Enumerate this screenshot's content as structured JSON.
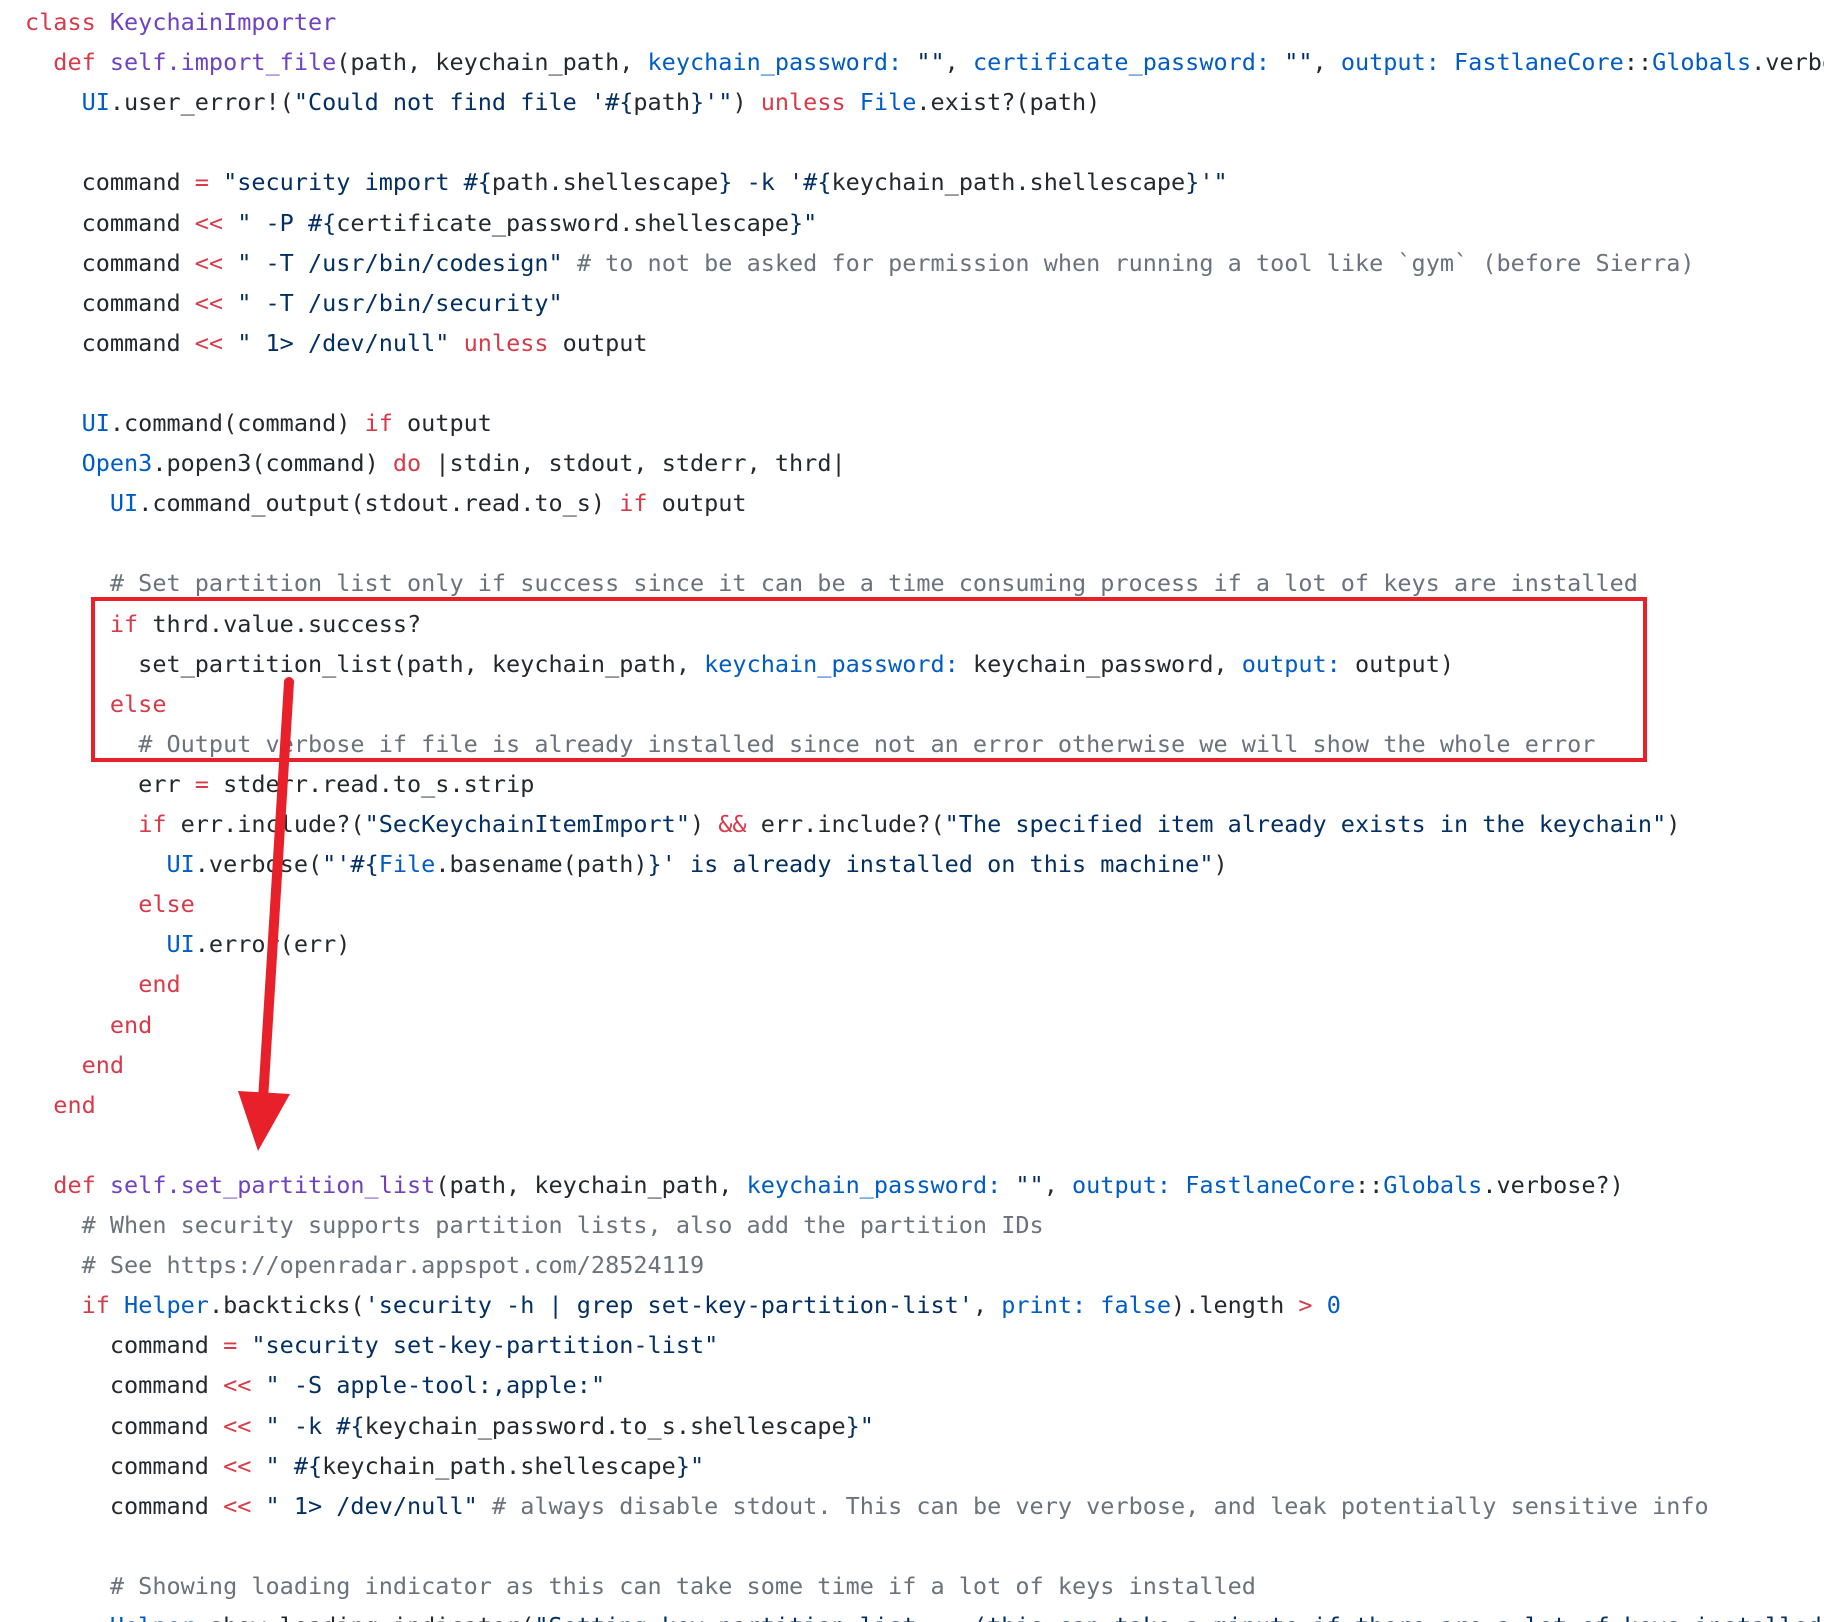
{
  "colors": {
    "keyword": "#d73a49",
    "class_name": "#6f42c1",
    "constant": "#005cc5",
    "string": "#032f62",
    "comment": "#6a737d",
    "text": "#24292e",
    "annotation": "#e8202a"
  },
  "code": {
    "language": "ruby",
    "lines": [
      [
        [
          "kw",
          "class "
        ],
        [
          "cls",
          "KeychainImporter"
        ]
      ],
      [
        [
          "p",
          "  "
        ],
        [
          "kw",
          "def "
        ],
        [
          "fn",
          "self.import_file"
        ],
        [
          "p",
          "(path, keychain_path, "
        ],
        [
          "sym",
          "keychain_password:"
        ],
        [
          "p",
          " "
        ],
        [
          "str",
          "\"\""
        ],
        [
          "p",
          ", "
        ],
        [
          "sym",
          "certificate_password:"
        ],
        [
          "p",
          " "
        ],
        [
          "str",
          "\"\""
        ],
        [
          "p",
          ", "
        ],
        [
          "sym",
          "output:"
        ],
        [
          "p",
          " "
        ],
        [
          "const",
          "FastlaneCore"
        ],
        [
          "p",
          "::"
        ],
        [
          "const",
          "Globals"
        ],
        [
          "p",
          ".verbose?)"
        ]
      ],
      [
        [
          "p",
          "    "
        ],
        [
          "const",
          "UI"
        ],
        [
          "p",
          ".user_error!("
        ],
        [
          "str",
          "\"Could not find file '#{"
        ],
        [
          "p",
          "path"
        ],
        [
          "str",
          "}'\""
        ],
        [
          "p",
          ") "
        ],
        [
          "kw",
          "unless"
        ],
        [
          "p",
          " "
        ],
        [
          "const",
          "File"
        ],
        [
          "p",
          ".exist?(path)"
        ]
      ],
      [],
      [
        [
          "p",
          "    command "
        ],
        [
          "op",
          "="
        ],
        [
          "p",
          " "
        ],
        [
          "str",
          "\"security import #{"
        ],
        [
          "p",
          "path.shellescape"
        ],
        [
          "str",
          "} -k '#{"
        ],
        [
          "p",
          "keychain_path.shellescape"
        ],
        [
          "str",
          "}'\""
        ]
      ],
      [
        [
          "p",
          "    command "
        ],
        [
          "op",
          "<<"
        ],
        [
          "p",
          " "
        ],
        [
          "str",
          "\" -P #{"
        ],
        [
          "p",
          "certificate_password.shellescape"
        ],
        [
          "str",
          "}\""
        ]
      ],
      [
        [
          "p",
          "    command "
        ],
        [
          "op",
          "<<"
        ],
        [
          "p",
          " "
        ],
        [
          "str",
          "\" -T /usr/bin/codesign\""
        ],
        [
          "p",
          " "
        ],
        [
          "cmt",
          "# to not be asked for permission when running a tool like `gym` (before Sierra)"
        ]
      ],
      [
        [
          "p",
          "    command "
        ],
        [
          "op",
          "<<"
        ],
        [
          "p",
          " "
        ],
        [
          "str",
          "\" -T /usr/bin/security\""
        ]
      ],
      [
        [
          "p",
          "    command "
        ],
        [
          "op",
          "<<"
        ],
        [
          "p",
          " "
        ],
        [
          "str",
          "\" 1> /dev/null\""
        ],
        [
          "p",
          " "
        ],
        [
          "kw",
          "unless"
        ],
        [
          "p",
          " output"
        ]
      ],
      [],
      [
        [
          "p",
          "    "
        ],
        [
          "const",
          "UI"
        ],
        [
          "p",
          ".command(command) "
        ],
        [
          "kw",
          "if"
        ],
        [
          "p",
          " output"
        ]
      ],
      [
        [
          "p",
          "    "
        ],
        [
          "const",
          "Open3"
        ],
        [
          "p",
          ".popen3(command) "
        ],
        [
          "kw",
          "do"
        ],
        [
          "p",
          " |stdin, stdout, stderr, thrd|"
        ]
      ],
      [
        [
          "p",
          "      "
        ],
        [
          "const",
          "UI"
        ],
        [
          "p",
          ".command_output(stdout.read.to_s) "
        ],
        [
          "kw",
          "if"
        ],
        [
          "p",
          " output"
        ]
      ],
      [],
      [
        [
          "p",
          "      "
        ],
        [
          "cmt",
          "# Set partition list only if success since it can be a time consuming process if a lot of keys are installed"
        ]
      ],
      [
        [
          "p",
          "      "
        ],
        [
          "kw",
          "if"
        ],
        [
          "p",
          " thrd.value.success?"
        ]
      ],
      [
        [
          "p",
          "        set_partition_list(path, keychain_path, "
        ],
        [
          "sym",
          "keychain_password:"
        ],
        [
          "p",
          " keychain_password, "
        ],
        [
          "sym",
          "output:"
        ],
        [
          "p",
          " output)"
        ]
      ],
      [
        [
          "p",
          "      "
        ],
        [
          "kw",
          "else"
        ]
      ],
      [
        [
          "p",
          "        "
        ],
        [
          "cmt",
          "# Output verbose if file is already installed since not an error otherwise we will show the whole error"
        ]
      ],
      [
        [
          "p",
          "        err "
        ],
        [
          "op",
          "="
        ],
        [
          "p",
          " stderr.read.to_s.strip"
        ]
      ],
      [
        [
          "p",
          "        "
        ],
        [
          "kw",
          "if"
        ],
        [
          "p",
          " err.include?("
        ],
        [
          "str",
          "\"SecKeychainItemImport\""
        ],
        [
          "p",
          ") "
        ],
        [
          "op",
          "&&"
        ],
        [
          "p",
          " err.include?("
        ],
        [
          "str",
          "\"The specified item already exists in the keychain\""
        ],
        [
          "p",
          ")"
        ]
      ],
      [
        [
          "p",
          "          "
        ],
        [
          "const",
          "UI"
        ],
        [
          "p",
          ".verbose("
        ],
        [
          "str",
          "\"'#{"
        ],
        [
          "const",
          "File"
        ],
        [
          "p",
          ".basename(path)"
        ],
        [
          "str",
          "}' is already installed on this machine\""
        ],
        [
          "p",
          ")"
        ]
      ],
      [
        [
          "p",
          "        "
        ],
        [
          "kw",
          "else"
        ]
      ],
      [
        [
          "p",
          "          "
        ],
        [
          "const",
          "UI"
        ],
        [
          "p",
          ".error(err)"
        ]
      ],
      [
        [
          "p",
          "        "
        ],
        [
          "kw",
          "end"
        ]
      ],
      [
        [
          "p",
          "      "
        ],
        [
          "kw",
          "end"
        ]
      ],
      [
        [
          "p",
          "    "
        ],
        [
          "kw",
          "end"
        ]
      ],
      [
        [
          "p",
          "  "
        ],
        [
          "kw",
          "end"
        ]
      ],
      [],
      [
        [
          "p",
          "  "
        ],
        [
          "kw",
          "def "
        ],
        [
          "fn",
          "self.set_partition_list"
        ],
        [
          "p",
          "(path, keychain_path, "
        ],
        [
          "sym",
          "keychain_password:"
        ],
        [
          "p",
          " "
        ],
        [
          "str",
          "\"\""
        ],
        [
          "p",
          ", "
        ],
        [
          "sym",
          "output:"
        ],
        [
          "p",
          " "
        ],
        [
          "const",
          "FastlaneCore"
        ],
        [
          "p",
          "::"
        ],
        [
          "const",
          "Globals"
        ],
        [
          "p",
          ".verbose?)"
        ]
      ],
      [
        [
          "p",
          "    "
        ],
        [
          "cmt",
          "# When security supports partition lists, also add the partition IDs"
        ]
      ],
      [
        [
          "p",
          "    "
        ],
        [
          "cmt",
          "# See https://openradar.appspot.com/28524119"
        ]
      ],
      [
        [
          "p",
          "    "
        ],
        [
          "kw",
          "if"
        ],
        [
          "p",
          " "
        ],
        [
          "const",
          "Helper"
        ],
        [
          "p",
          ".backticks("
        ],
        [
          "str",
          "'security -h | grep set-key-partition-list'"
        ],
        [
          "p",
          ", "
        ],
        [
          "sym",
          "print:"
        ],
        [
          "p",
          " "
        ],
        [
          "const",
          "false"
        ],
        [
          "p",
          ").length "
        ],
        [
          "op",
          ">"
        ],
        [
          "p",
          " "
        ],
        [
          "num",
          "0"
        ]
      ],
      [
        [
          "p",
          "      command "
        ],
        [
          "op",
          "="
        ],
        [
          "p",
          " "
        ],
        [
          "str",
          "\"security set-key-partition-list\""
        ]
      ],
      [
        [
          "p",
          "      command "
        ],
        [
          "op",
          "<<"
        ],
        [
          "p",
          " "
        ],
        [
          "str",
          "\" -S apple-tool:,apple:\""
        ]
      ],
      [
        [
          "p",
          "      command "
        ],
        [
          "op",
          "<<"
        ],
        [
          "p",
          " "
        ],
        [
          "str",
          "\" -k #{"
        ],
        [
          "p",
          "keychain_password.to_s.shellescape"
        ],
        [
          "str",
          "}\""
        ]
      ],
      [
        [
          "p",
          "      command "
        ],
        [
          "op",
          "<<"
        ],
        [
          "p",
          " "
        ],
        [
          "str",
          "\" #{"
        ],
        [
          "p",
          "keychain_path.shellescape"
        ],
        [
          "str",
          "}\""
        ]
      ],
      [
        [
          "p",
          "      command "
        ],
        [
          "op",
          "<<"
        ],
        [
          "p",
          " "
        ],
        [
          "str",
          "\" 1> /dev/null\""
        ],
        [
          "p",
          " "
        ],
        [
          "cmt",
          "# always disable stdout. This can be very verbose, and leak potentially sensitive info"
        ]
      ],
      [],
      [
        [
          "p",
          "      "
        ],
        [
          "cmt",
          "# Showing loading indicator as this can take some time if a lot of keys installed"
        ]
      ],
      [
        [
          "p",
          "      "
        ],
        [
          "const",
          "Helper"
        ],
        [
          "p",
          ".show_loading_indicator("
        ],
        [
          "str",
          "\"Setting key partition list... (this can take a minute if there are a lot of keys installed)\""
        ],
        [
          "p",
          ")"
        ]
      ]
    ]
  }
}
